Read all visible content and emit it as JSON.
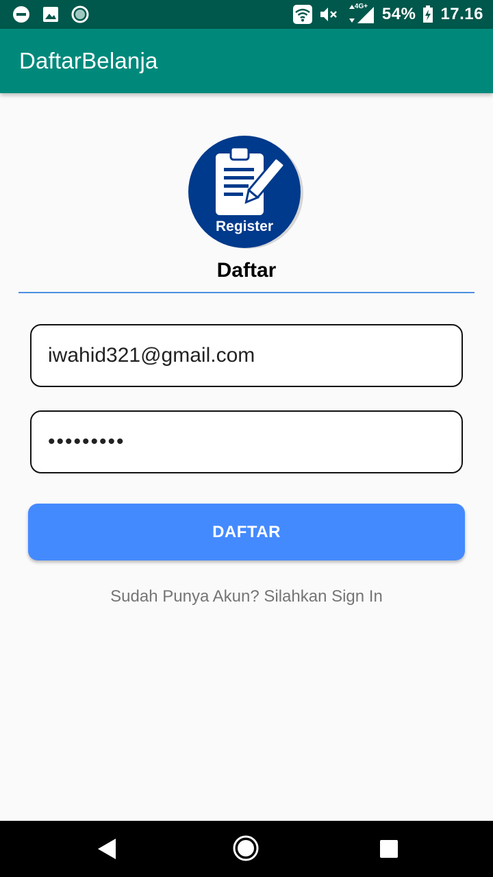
{
  "status_bar": {
    "left_icons": [
      "dnd-icon",
      "image-icon",
      "record-icon"
    ],
    "right_icons": [
      "wifi-icon",
      "mute-icon",
      "signal-icon",
      "battery-icon"
    ],
    "network": "4G+",
    "battery": "54%",
    "time": "17.16"
  },
  "app_bar": {
    "title": "DaftarBelanja"
  },
  "logo": {
    "label": "Register",
    "icon": "clipboard-pen-icon",
    "bg_color": "#003a8c"
  },
  "form": {
    "heading": "Daftar",
    "email_value": "iwahid321@gmail.com",
    "password_value": "•••••••••",
    "submit_label": "DAFTAR",
    "signin_text": "Sudah Punya Akun? Silahkan Sign In"
  },
  "colors": {
    "status_bar": "#00574b",
    "app_bar": "#00897b",
    "button": "#448aff",
    "divider": "#4a8fe0"
  },
  "nav_bar": {
    "icons": [
      "back-icon",
      "home-icon",
      "recents-icon"
    ]
  }
}
